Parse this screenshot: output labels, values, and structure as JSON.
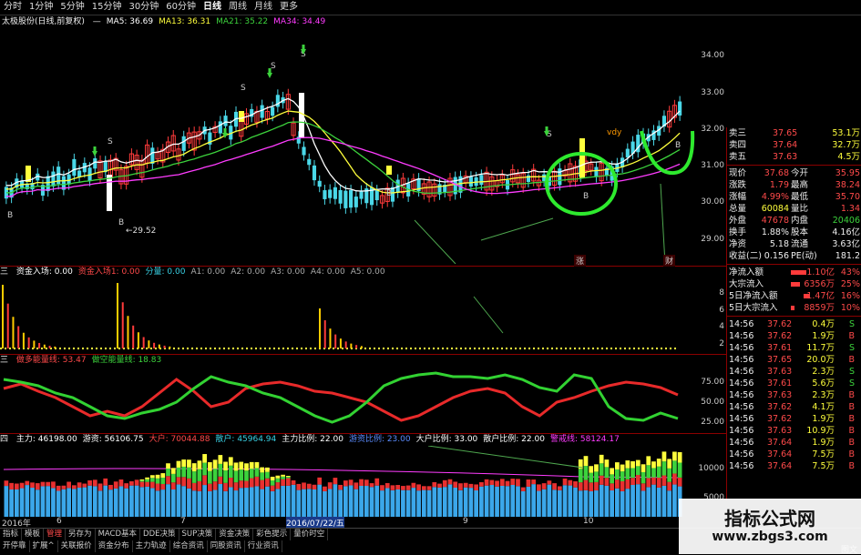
{
  "timeframe_tabs": [
    "分时",
    "1分钟",
    "5分钟",
    "15分钟",
    "30分钟",
    "60分钟",
    "日线",
    "周线",
    "月线",
    "更多"
  ],
  "active_tab": "日线",
  "main": {
    "title": "太极股份(日线,前复权)",
    "ma": [
      {
        "label": "MA5: 36.69",
        "color": "#ffffff"
      },
      {
        "label": "MA13: 36.31",
        "color": "#ffff3c"
      },
      {
        "label": "MA21: 35.22",
        "color": "#3cd23c"
      },
      {
        "label": "MA34: 34.49",
        "color": "#ff3cff"
      }
    ],
    "low_label": "29.52",
    "yaxis": [
      "34.00",
      "33.00",
      "32.00",
      "31.00",
      "30.00",
      "29.00"
    ],
    "marker_S": "S",
    "marker_B": "B",
    "vdy": "vdy"
  },
  "panel1": {
    "prefix": "三",
    "items": [
      {
        "label": "资金入场: 0.00",
        "color": "#ffffff"
      },
      {
        "label": "资金入场1: 0.00",
        "color": "#ff4a4a"
      },
      {
        "label": "分量: 0.00",
        "color": "#39d2e6"
      },
      {
        "label": "A1: 0.00",
        "color": "#aaaaaa"
      },
      {
        "label": "A2: 0.00",
        "color": "#aaaaaa"
      },
      {
        "label": "A3: 0.00",
        "color": "#aaaaaa"
      },
      {
        "label": "A4: 0.00",
        "color": "#aaaaaa"
      },
      {
        "label": "A5: 0.00",
        "color": "#aaaaaa"
      }
    ],
    "yaxis": [
      "8",
      "6",
      "4",
      "2"
    ]
  },
  "panel2": {
    "prefix": "三",
    "items": [
      {
        "label": "做多能量线: 53.47",
        "color": "#ff4a4a"
      },
      {
        "label": "做空能量线: 18.83",
        "color": "#3cd23c"
      }
    ],
    "yaxis": [
      "75.00",
      "50.00",
      "25.00"
    ]
  },
  "panel3": {
    "prefix": "四",
    "items": [
      {
        "label": "主力: 46198.00",
        "color": "#ffffff"
      },
      {
        "label": "游资: 56106.75",
        "color": "#ffffff"
      },
      {
        "label": "大户: 70044.88",
        "color": "#ff4a4a"
      },
      {
        "label": "散户: 45964.94",
        "color": "#39d2e6"
      },
      {
        "label": "主力比例: 22.00",
        "color": "#ffffff"
      },
      {
        "label": "游资比例: 23.00",
        "color": "#5b8cff"
      },
      {
        "label": "大户比例: 33.00",
        "color": "#ffffff"
      },
      {
        "label": "散户比例: 22.00",
        "color": "#ffffff"
      },
      {
        "label": "警戒线: 58124.17",
        "color": "#ff3cff"
      }
    ],
    "yaxis": [
      "10000",
      "5000"
    ]
  },
  "dates": [
    "2016年",
    "6",
    "7",
    "2016/07/22/五",
    "9",
    "10"
  ],
  "side": {
    "sells": [
      {
        "name": "卖三",
        "price": "37.65",
        "vol": "53.1万"
      },
      {
        "name": "卖四",
        "price": "37.64",
        "vol": "32.7万"
      },
      {
        "name": "卖五",
        "price": "37.63",
        "vol": "4.5万"
      }
    ],
    "stats": [
      {
        "l1": "现价",
        "v1": "37.68",
        "l2": "今开",
        "v2": "35.95",
        "c1": "red",
        "c2": "red"
      },
      {
        "l1": "涨跌",
        "v1": "1.79",
        "l2": "最高",
        "v2": "38.24",
        "c1": "red",
        "c2": "red"
      },
      {
        "l1": "涨幅",
        "v1": "4.99%",
        "l2": "最低",
        "v2": "35.70",
        "c1": "red",
        "c2": "red"
      },
      {
        "l1": "总量",
        "v1": "60084",
        "l2": "量比",
        "v2": "1.34",
        "c1": "yellow",
        "c2": "red"
      },
      {
        "l1": "外盘",
        "v1": "47678",
        "l2": "内盘",
        "v2": "20406",
        "c1": "red",
        "c2": "green"
      },
      {
        "l1": "换手",
        "v1": "1.88%",
        "l2": "股本",
        "v2": "4.16亿",
        "c1": "white",
        "c2": "white"
      },
      {
        "l1": "净资",
        "v1": "5.18",
        "l2": "流通",
        "v2": "3.63亿",
        "c1": "white",
        "c2": "white"
      },
      {
        "l1": "收益(二)",
        "v1": "0.156",
        "l2": "PE(动)",
        "v2": "181.2",
        "c1": "white",
        "c2": "white"
      }
    ],
    "flows": [
      {
        "name": "净流入额",
        "val": "1.10亿",
        "pct": "43%",
        "bar": 0.43
      },
      {
        "name": "大宗流入",
        "val": "6356万",
        "pct": "25%",
        "bar": 0.25
      },
      {
        "name": "5日净流入额",
        "val": "1.47亿",
        "pct": "16%",
        "bar": 0.16
      },
      {
        "name": "5日大宗流入",
        "val": "8859万",
        "pct": "10%",
        "bar": 0.1
      }
    ],
    "ticks": [
      {
        "t": "14:56",
        "p": "37.62",
        "v": "0.4万",
        "d": "S"
      },
      {
        "t": "14:56",
        "p": "37.62",
        "v": "1.9万",
        "d": "B"
      },
      {
        "t": "14:56",
        "p": "37.61",
        "v": "11.7万",
        "d": "S"
      },
      {
        "t": "14:56",
        "p": "37.65",
        "v": "20.0万",
        "d": "B"
      },
      {
        "t": "14:56",
        "p": "37.63",
        "v": "2.3万",
        "d": "S"
      },
      {
        "t": "14:56",
        "p": "37.61",
        "v": "5.6万",
        "d": "S"
      },
      {
        "t": "14:56",
        "p": "37.63",
        "v": "2.3万",
        "d": "B"
      },
      {
        "t": "14:56",
        "p": "37.62",
        "v": "4.1万",
        "d": "B"
      },
      {
        "t": "14:56",
        "p": "37.62",
        "v": "1.9万",
        "d": "B"
      },
      {
        "t": "14:56",
        "p": "37.63",
        "v": "10.9万",
        "d": "B"
      },
      {
        "t": "14:56",
        "p": "37.64",
        "v": "1.9万",
        "d": "B"
      },
      {
        "t": "14:56",
        "p": "37.64",
        "v": "7.5万",
        "d": "B"
      },
      {
        "t": "14:56",
        "p": "37.64",
        "v": "7.5万",
        "d": "B"
      }
    ],
    "zhang": "涨",
    "cai": "财"
  },
  "bottom": {
    "row1": [
      "指标",
      "模板",
      "管理",
      "另存为",
      "MACD基本",
      "DDE决策",
      "SUP决策",
      "资金决策",
      "彩色提示",
      "量价时空"
    ],
    "row2": [
      "开停靠",
      "扩展^",
      "关联报价",
      "资金分布",
      "主力轨迹",
      "综合资讯",
      "同股资讯",
      "行业资讯"
    ],
    "right": "图文"
  },
  "watermark": {
    "line1": "指标公式网",
    "line2": "www.zbgs3.com"
  }
}
